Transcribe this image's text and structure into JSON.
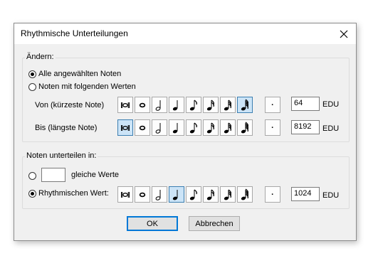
{
  "dialog": {
    "title": "Rhythmische Unterteilungen"
  },
  "change_group": {
    "label": "Ändern:",
    "radio_all": "Alle angewählten Noten",
    "radio_following": "Noten mit folgenden Werten",
    "selected": "all"
  },
  "from_row": {
    "label": "Von (kürzeste Note)",
    "value": "64",
    "unit": "EDU"
  },
  "to_row": {
    "label": "Bis (längste Note)",
    "value": "8192",
    "unit": "EDU"
  },
  "subdivide_group": {
    "label": "Noten unterteilen in:",
    "equal_value": "",
    "equal_label": "gleiche Werte",
    "rhythmic_label": "Rhythmischen Wert:",
    "rhythmic_value": "1024",
    "unit": "EDU",
    "selected": "rhythmic"
  },
  "buttons": {
    "ok": "OK",
    "cancel": "Abbrechen"
  },
  "note_palette": {
    "items": [
      "double-whole-note-icon",
      "whole-note-icon",
      "half-note-icon",
      "quarter-note-icon",
      "eighth-note-icon",
      "sixteenth-note-icon",
      "thirty-second-note-icon",
      "sixty-fourth-note-icon"
    ],
    "dot": "augmentation-dot-icon",
    "from_selected": "sixty-fourth-note-icon",
    "to_selected": "double-whole-note-icon",
    "rhythmic_selected": "quarter-note-icon"
  },
  "colors": {
    "selected_fill": "#cce4f7",
    "selected_border": "#3c7fb1",
    "default_button_border": "#0078d7"
  }
}
